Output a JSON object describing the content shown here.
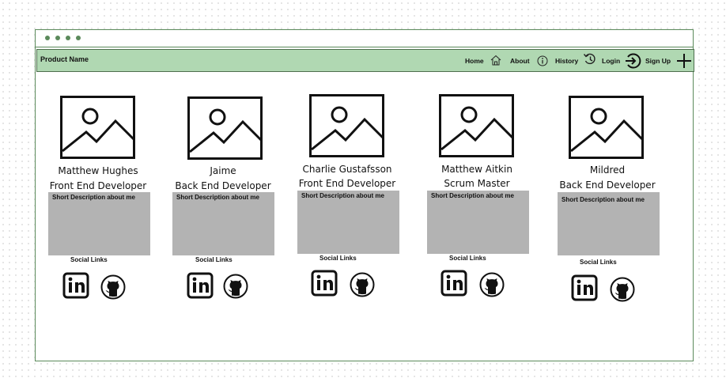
{
  "header": {
    "product_name": "Product Name",
    "nav": [
      {
        "label": "Home",
        "icon": "home-icon"
      },
      {
        "label": "About",
        "icon": "info-icon"
      },
      {
        "label": "History",
        "icon": "history-icon"
      },
      {
        "label": "Login",
        "icon": "login-icon"
      },
      {
        "label": "Sign Up",
        "icon": "plus-icon"
      }
    ]
  },
  "team": [
    {
      "name": "Matthew Hughes",
      "role": "Front End Developer",
      "description": "Short Description about me",
      "social_label": "Social Links"
    },
    {
      "name": "Jaime",
      "role": "Back End Developer",
      "description": "Short Description about me",
      "social_label": "Social Links"
    },
    {
      "name": "Charlie Gustafsson",
      "role": "Front End Developer",
      "description": "Short Description about me",
      "social_label": "Social Links"
    },
    {
      "name": "Matthew Aitkin",
      "role": "Scrum Master",
      "description": "Short Description about me",
      "social_label": "Social Links"
    },
    {
      "name": "Mildred",
      "role": "Back End Developer",
      "description": "Short Description about me",
      "social_label": "Social Links"
    }
  ],
  "colors": {
    "navbar": "#b0d8b2",
    "frame": "#5b8a5b",
    "description_box": "#b3b3b3"
  }
}
